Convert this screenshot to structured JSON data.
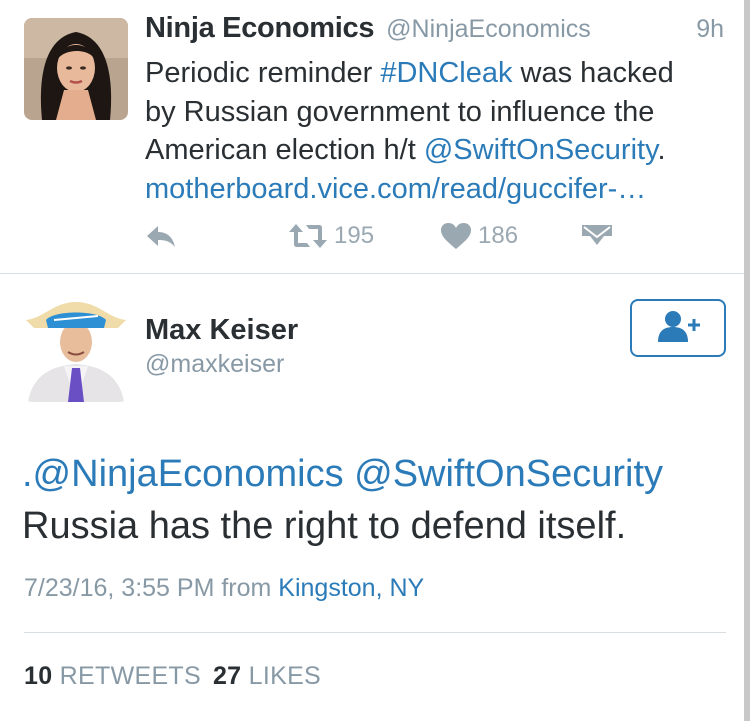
{
  "tweet1": {
    "author_name": "Ninja Economics",
    "author_handle": "@NinjaEconomics",
    "time_ago": "9h",
    "text_line1_pre": "Periodic reminder ",
    "text_line1_hashtag": "#DNCleak",
    "text_line1_post": " was hacked",
    "text_line2": "by Russian government to influence the",
    "text_line3_pre": "American election h/t ",
    "text_line3_mention": "@SwiftOnSecurity",
    "text_line3_post": ".",
    "text_line4_link": "motherboard.vice.com/read/guccifer-…",
    "retweet_count": "195",
    "like_count": "186",
    "icons": [
      "reply-icon",
      "retweet-icon",
      "heart-icon",
      "direct-message-icon"
    ]
  },
  "tweet2": {
    "author_name": "Max Keiser",
    "author_handle": "@maxkeiser",
    "text_line1": ".@NinjaEconomics @SwiftOnSecurity",
    "text_line2": "Russia has the right to defend itself.",
    "timestamp": "7/23/16, 3:55 PM from ",
    "location": "Kingston, NY",
    "retweets_count": "10",
    "retweets_label": "RETWEETS",
    "likes_count": "27",
    "likes_label": "LIKES",
    "follow_icon": "add-user-icon"
  },
  "colors": {
    "link": "#2b7bb9",
    "muted": "#8899a6",
    "text": "#292f33",
    "divider": "#d8dde1"
  }
}
